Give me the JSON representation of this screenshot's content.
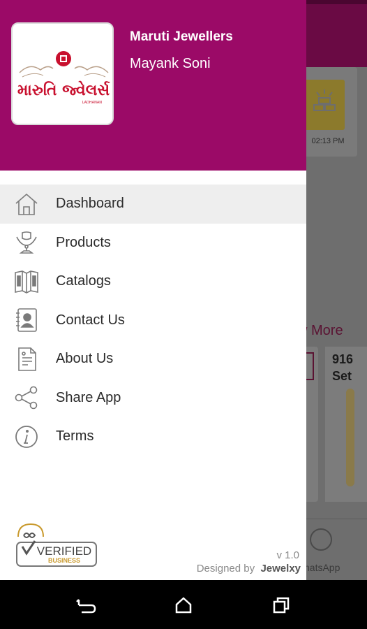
{
  "drawer": {
    "store_name": "Maruti Jewellers",
    "user_name": "Mayank Soni",
    "logo_text": "મારુતિ જ્વેલર્સ",
    "logo_subtext": "LADHANAN",
    "menu": [
      {
        "label": "Dashboard",
        "icon": "home-icon",
        "active": true
      },
      {
        "label": "Products",
        "icon": "jewellery-stand-icon",
        "active": false
      },
      {
        "label": "Catalogs",
        "icon": "catalog-icon",
        "active": false
      },
      {
        "label": "Contact Us",
        "icon": "contact-card-icon",
        "active": false
      },
      {
        "label": "About Us",
        "icon": "document-icon",
        "active": false
      },
      {
        "label": "Share App",
        "icon": "share-icon",
        "active": false
      },
      {
        "label": "Terms",
        "icon": "info-icon",
        "active": false
      }
    ],
    "verified_badge": {
      "line1": "VERIFIED",
      "line2": "BUSINESS"
    },
    "version": "v 1.0",
    "designed_by_prefix": "Designed by",
    "designed_by_brand": "Jewelxy"
  },
  "background": {
    "rate_time": "02:13 PM",
    "view_more": "w More",
    "product_code": "916",
    "product_code_line2": "Set",
    "whatsapp_label": "hatsApp"
  },
  "colors": {
    "drawer_header": "#9b0a67",
    "active_item_bg": "#eeeeee",
    "logo_red": "#c8102e"
  },
  "nav": {
    "back": "back-icon",
    "home": "home-nav-icon",
    "recents": "recents-icon"
  }
}
